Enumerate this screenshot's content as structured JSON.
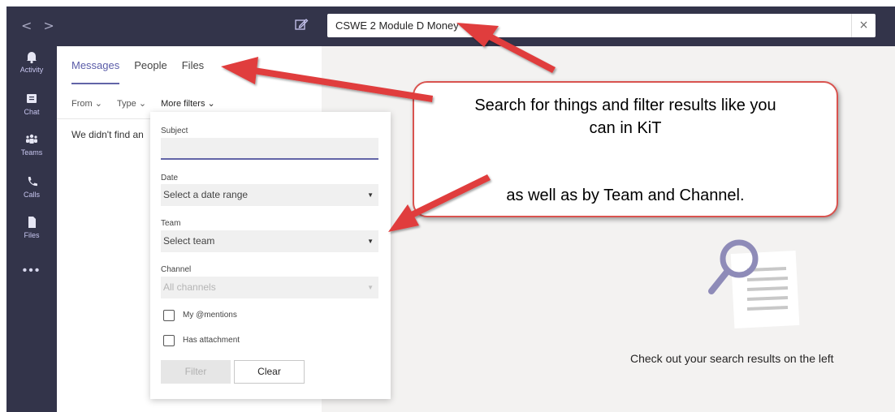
{
  "search": {
    "value": "CSWE 2 Module D Money",
    "clear_label": "×"
  },
  "nav": {
    "back": "<",
    "forward": ">"
  },
  "rail": {
    "items": [
      {
        "label": "Activity",
        "icon": "bell-icon"
      },
      {
        "label": "Chat",
        "icon": "chat-icon"
      },
      {
        "label": "Teams",
        "icon": "teams-icon"
      },
      {
        "label": "Calls",
        "icon": "phone-icon"
      },
      {
        "label": "Files",
        "icon": "file-icon"
      }
    ],
    "more": "•••"
  },
  "tabs": [
    {
      "label": "Messages",
      "active": true
    },
    {
      "label": "People",
      "active": false
    },
    {
      "label": "Files",
      "active": false
    }
  ],
  "filters": {
    "from": "From ⌄",
    "type": "Type ⌄",
    "more": "More filters ⌄"
  },
  "no_results": "We didn't find an",
  "more_filters": {
    "subject_label": "Subject",
    "subject_value": "",
    "date_label": "Date",
    "date_value": "Select a date range",
    "team_label": "Team",
    "team_value": "Select team",
    "channel_label": "Channel",
    "channel_value": "All channels",
    "mentions_label": "My @mentions",
    "attachment_label": "Has attachment",
    "filter_button": "Filter",
    "clear_button": "Clear"
  },
  "empty_state": {
    "text": "Check out your search results on the left"
  },
  "callout": {
    "line1": "Search for things and filter results like you",
    "line1b": "can in KiT",
    "line2": "as well as by Team and Channel."
  },
  "colors": {
    "rail": "#33344a",
    "accent": "#6264a7",
    "callout_border": "#d9534f",
    "arrow": "#e03c3c"
  }
}
